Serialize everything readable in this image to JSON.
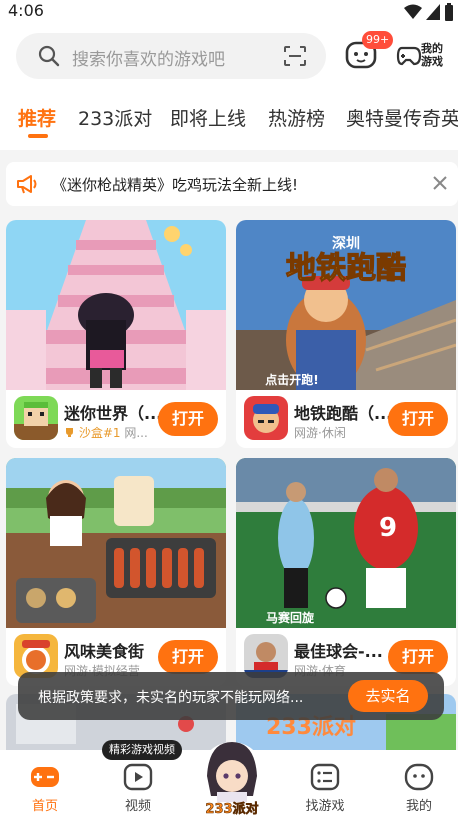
{
  "status_bar": {
    "time": "4:06"
  },
  "search": {
    "placeholder": "搜索你喜欢的游戏吧"
  },
  "header": {
    "message_badge": "99+",
    "my_games_label": "我的游戏"
  },
  "tabs": [
    {
      "label": "推荐"
    },
    {
      "label": "233派对"
    },
    {
      "label": "即将上线"
    },
    {
      "label": "热游榜"
    },
    {
      "label": "奥特曼传奇英"
    }
  ],
  "notice": {
    "text": "《迷你枪战精英》吃鸡玩法全新上线!"
  },
  "games": [
    {
      "name": "迷你世界（...",
      "meta_badge": "沙盒#1",
      "meta": " 网...",
      "button": "打开"
    },
    {
      "name": "地铁跑酷（...",
      "meta": "网游·休闲",
      "button": "打开"
    },
    {
      "name": "风味美食街",
      "meta": "网游·模拟经营",
      "button": "打开"
    },
    {
      "name": "最佳球会-...",
      "meta": "网游·体育",
      "button": "打开"
    }
  ],
  "cover_text": {
    "subway_top": "深圳",
    "subway_title": "地铁跑酷",
    "subway_sub": "点击开跑!",
    "soccer_sub": "马赛回旋",
    "soccer_number": "9",
    "party_logo": "233派对"
  },
  "toast": {
    "text": "根据政策要求，未实名的玩家不能玩网络...",
    "button": "去实名"
  },
  "bottom_nav": {
    "items": [
      {
        "label": "首页"
      },
      {
        "label": "视频"
      },
      {
        "label": "找游戏"
      },
      {
        "label": "我的"
      }
    ],
    "video_tip": "精彩游戏视频",
    "center_label": "233派对"
  },
  "colors": {
    "accent": "#ff7210",
    "badge": "#ff4d3a"
  }
}
